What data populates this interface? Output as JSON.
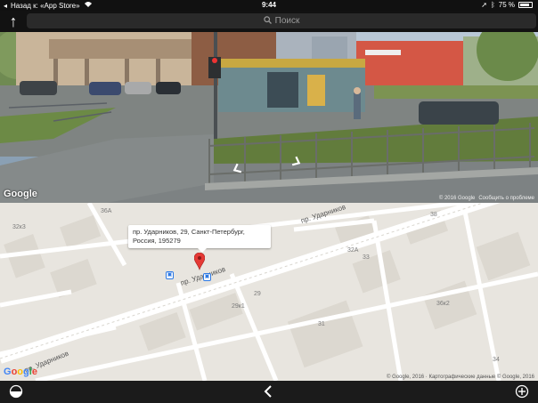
{
  "status_bar": {
    "back_label": "Назад к: «App Store»",
    "time": "9:44",
    "battery": "75 %"
  },
  "toolbar": {
    "search_placeholder": "Поиск"
  },
  "street_view": {
    "logo": "Google",
    "copyright": "© 2016 Google",
    "report_link": "Сообщить о проблеме"
  },
  "map": {
    "callout_address": "пр. Ударников, 29, Санкт-Петербург, Россия, 195279",
    "streets": [
      "пр. Ударников",
      "пр. Ударников",
      "пр. Ударников"
    ],
    "building_numbers": [
      "36А",
      "32к3",
      "38",
      "32А",
      "33",
      "29",
      "29к1",
      "36к2",
      "31",
      "34"
    ],
    "logo": "Google",
    "copyright": "© Google, 2016 · Картографические данные © Google, 2016"
  },
  "colors": {
    "pin": "#e53935",
    "bus_stop": "#2b78e4"
  },
  "icons": {
    "map_mode": "half-circle-icon",
    "back": "chevron-left-icon",
    "add": "plus-circle-icon"
  }
}
